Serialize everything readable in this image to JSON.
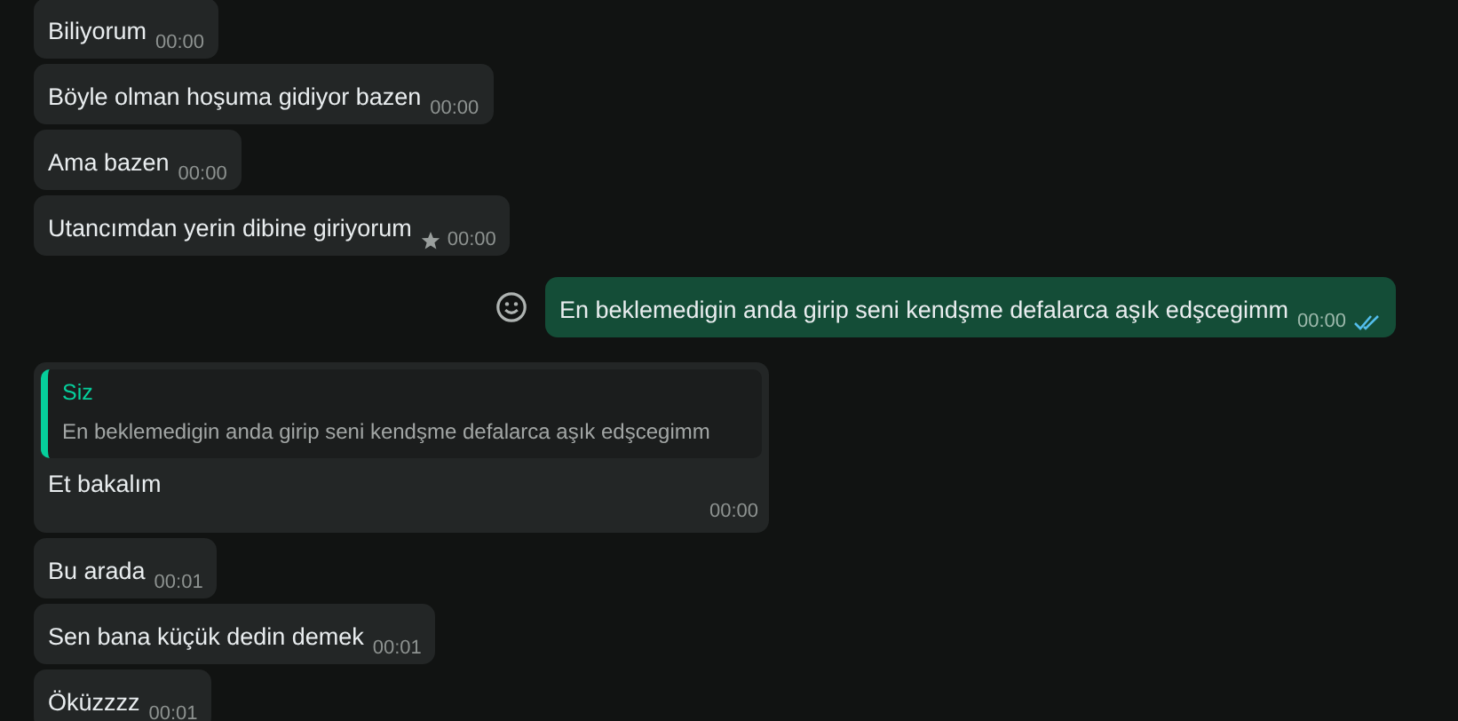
{
  "messages": [
    {
      "kind": "in",
      "text": "Biliyorum",
      "time": "00:00",
      "starred": false
    },
    {
      "kind": "in",
      "text": "Böyle olman hoşuma gidiyor bazen",
      "time": "00:00",
      "starred": false
    },
    {
      "kind": "in",
      "text": "Ama bazen",
      "time": "00:00",
      "starred": false
    },
    {
      "kind": "in",
      "text": "Utancımdan yerin dibine giriyorum",
      "time": "00:00",
      "starred": true
    },
    {
      "kind": "out",
      "text": "En beklemedigin anda girip seni kendşme defalarca aşık edşcegimm",
      "time": "00:00",
      "starred": false,
      "read": true
    },
    {
      "kind": "in",
      "text": "Et bakalım",
      "time": "00:00",
      "starred": false,
      "reply": {
        "author": "Siz",
        "text": "En beklemedigin anda girip seni kendşme defalarca aşık edşcegimm"
      }
    },
    {
      "kind": "in",
      "text": "Bu arada",
      "time": "00:01",
      "starred": false
    },
    {
      "kind": "in",
      "text": "Sen bana küçük dedin demek",
      "time": "00:01",
      "starred": false
    },
    {
      "kind": "in",
      "text": "Öküzzzz",
      "time": "00:01",
      "starred": false
    }
  ]
}
